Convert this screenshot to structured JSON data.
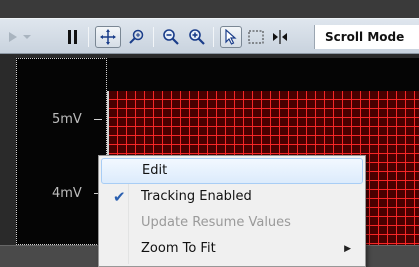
{
  "toolbar": {
    "mode_label": "Scroll Mode",
    "tools": [
      {
        "icon": "play-icon"
      },
      {
        "icon": "dropdown-arrow-icon"
      },
      {
        "icon": "pause-icon"
      },
      {
        "icon": "pan-icon",
        "active": true
      },
      {
        "icon": "zoom-fit-icon"
      },
      {
        "icon": "zoom-out-icon"
      },
      {
        "icon": "zoom-in-icon"
      },
      {
        "icon": "pointer-select-icon",
        "active": true
      },
      {
        "icon": "marquee-select-icon"
      },
      {
        "icon": "cursor-split-icon"
      }
    ]
  },
  "plot": {
    "y_labels": [
      "5mV",
      "4mV"
    ],
    "grid_color": "#ff2828",
    "background_color": "#050505"
  },
  "context_menu": {
    "items": [
      {
        "label": "Edit",
        "highlighted": true,
        "checked": false,
        "enabled": true,
        "submenu": false
      },
      {
        "label": "Tracking Enabled",
        "highlighted": false,
        "checked": true,
        "enabled": true,
        "submenu": false
      },
      {
        "label": "Update Resume Values",
        "highlighted": false,
        "checked": false,
        "enabled": false,
        "submenu": false
      },
      {
        "label": "Zoom To Fit",
        "highlighted": false,
        "checked": false,
        "enabled": true,
        "submenu": true
      }
    ]
  }
}
